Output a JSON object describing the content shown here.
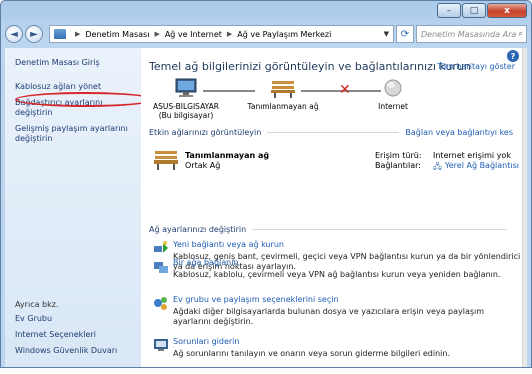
{
  "titlebar": {
    "minimize": "–",
    "maximize": "□",
    "close": "x"
  },
  "address": {
    "back": "◄",
    "forward": "►",
    "crumbs": [
      "Denetim Masası",
      "Ağ ve Internet",
      "Ağ ve Paylaşım Merkezi"
    ],
    "search_placeholder": "Denetim Masasında Ara"
  },
  "left_pane": {
    "home": "Denetim Masası Giriş",
    "links": [
      "Kablosuz ağları yönet",
      "Bağdaştırıcı ayarlarını değiştirin",
      "Gelişmiş paylaşım ayarlarını değiştirin"
    ],
    "see_also": "Ayrıca bkz.",
    "bottom_links": [
      "Ev Grubu",
      "Internet Seçenekleri",
      "Windows Güvenlik Duvarı"
    ]
  },
  "main": {
    "title": "Temel ağ bilgilerinizi görüntüleyin ve bağlantılarınızı kurun",
    "full_map": "Tüm haritayı göster",
    "nodes": [
      {
        "label": "ASUS-BILGISAYAR",
        "sub": "(Bu bilgisayar)"
      },
      {
        "label": "Tanımlanmayan ağ",
        "sub": ""
      },
      {
        "label": "Internet",
        "sub": ""
      }
    ],
    "active_section": "Etkin ağlarınızı görüntüleyin",
    "connect_link": "Bağlan veya bağlantıyı kes",
    "active_network": {
      "name": "Tanımlanmayan ağ",
      "type": "Ortak Ağ",
      "access_label": "Erişim türü:",
      "access_value": "Internet erişimi yok",
      "connections_label": "Bağlantılar:",
      "connections_value": "Yerel Ağ Bağlantısı"
    },
    "change_section": "Ağ ayarlarınızı değiştirin",
    "tasks": [
      {
        "link": "Yeni bağlantı veya ağ kurun",
        "desc": "Kablosuz, geniş bant, çevirmeli, geçici veya VPN bağlantısı kurun ya da bir yönlendirici ya da erişim noktası ayarlayın."
      },
      {
        "link": "Bir ağa bağlanın",
        "desc": "Kablosuz, kablolu, çevirmeli veya VPN ağ bağlantısı kurun veya yeniden bağlanın."
      },
      {
        "link": "Ev grubu ve paylaşım seçeneklerini seçin",
        "desc": "Ağdaki diğer bilgisayarlarda bulunan dosya ve yazıcılara erişin veya paylaşım ayarlarını değiştirin."
      },
      {
        "link": "Sorunları giderin",
        "desc": "Ağ sorunlarını tanılayın ve onarın veya sorun giderme bilgileri edinin."
      }
    ]
  },
  "colors": {
    "link": "#1e5cb3",
    "highlight": "#d6282b",
    "title": "#1e395b"
  }
}
